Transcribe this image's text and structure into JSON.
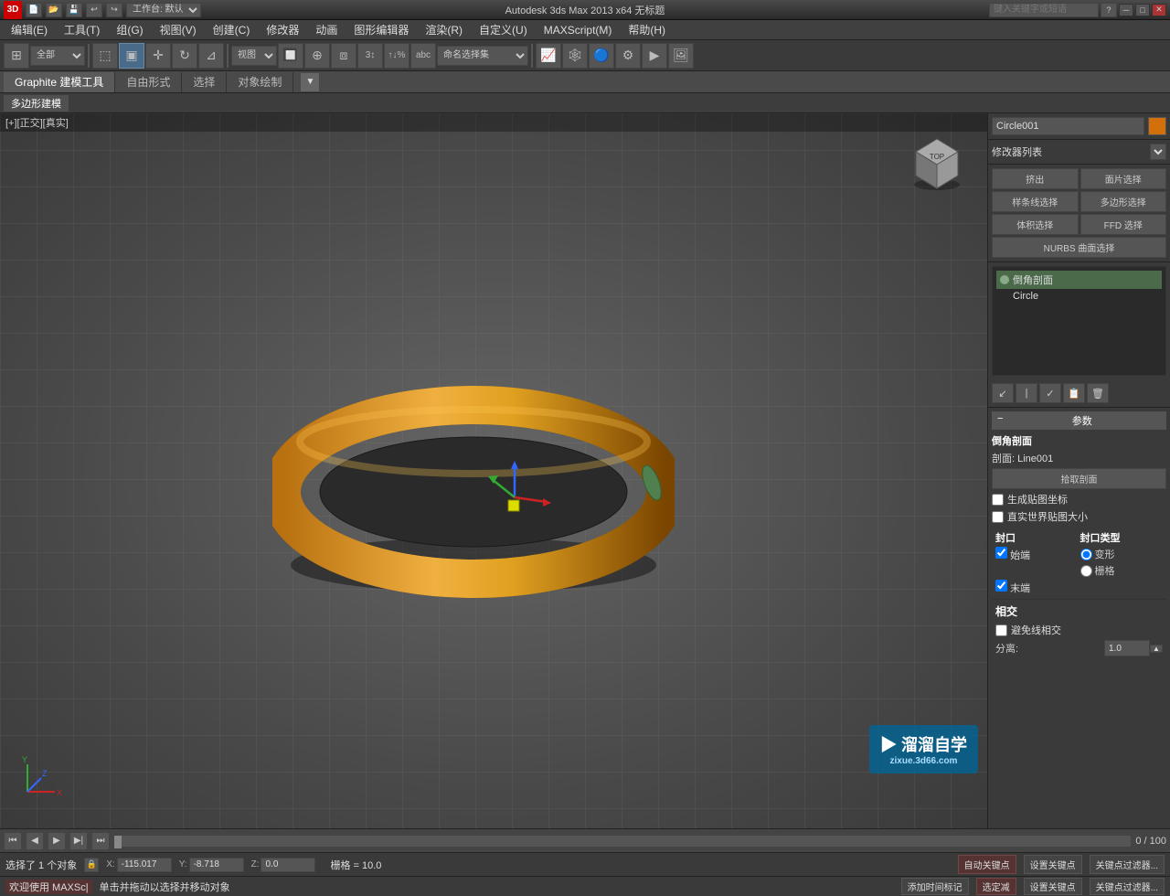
{
  "titlebar": {
    "title": "Autodesk 3ds Max 2013 x64 无标题",
    "logo": "3D",
    "workspace_label": "工作台: 默认",
    "search_placeholder": "键入关键字或短语",
    "min_btn": "─",
    "max_btn": "□",
    "close_btn": "✕"
  },
  "menu": {
    "items": [
      "编辑(E)",
      "工具(T)",
      "组(G)",
      "视图(V)",
      "创建(C)",
      "修改器",
      "动画",
      "图形编辑器",
      "渲染(R)",
      "自定义(U)",
      "MAXScript(M)",
      "帮助(H)"
    ]
  },
  "tabs": {
    "items": [
      "Graphite 建模工具",
      "自由形式",
      "选择",
      "对象绘制"
    ],
    "active": "Graphite 建模工具",
    "sub_item": "多边形建模"
  },
  "viewport": {
    "header": "[+][正交][真实]",
    "object_name": "Circle001"
  },
  "right_panel": {
    "object_name": "Circle001",
    "modifier_list_label": "修改器列表",
    "modifier_buttons": [
      {
        "label": "挤出",
        "wide": false
      },
      {
        "label": "面片选择",
        "wide": false
      },
      {
        "label": "样条线选择",
        "wide": false
      },
      {
        "label": "多边形选择",
        "wide": false
      },
      {
        "label": "体积选择",
        "wide": false
      },
      {
        "label": "FFD 选择",
        "wide": false
      },
      {
        "label": "NURBS 曲面选择",
        "wide": true
      }
    ],
    "modifier_stack": {
      "items": [
        {
          "name": "倒角剖面",
          "active": true,
          "has_icon": true
        },
        {
          "name": "Circle",
          "active": false,
          "has_icon": false
        }
      ]
    },
    "stack_tools": [
      "↙",
      "|",
      "✓",
      "📋",
      "🗑"
    ],
    "params_section": {
      "title": "参数",
      "bevel_section_label": "倒角剖面",
      "section_label": "剖面: Line001",
      "pick_btn": "拾取剖面",
      "checkboxes": [
        {
          "label": "生成贴图坐标",
          "checked": false
        },
        {
          "label": "直实世界贴图大小",
          "checked": false
        }
      ],
      "cap_section": {
        "title": "封口",
        "start_label": "始端",
        "end_label": "末端",
        "start_checked": true,
        "end_checked": true,
        "cap_type_title": "封口类型",
        "morph_label": "变形",
        "grid_label": "栅格",
        "morph_checked": true,
        "grid_checked": false
      },
      "intersect_section": {
        "title": "相交",
        "avoid_label": "避免线相交",
        "avoid_checked": false,
        "separation_label": "分离:",
        "separation_value": "1.0"
      }
    }
  },
  "timeline": {
    "frame_current": "0",
    "frame_total": "100"
  },
  "status": {
    "text": "选择了 1 个对象",
    "coord_x_label": "X:",
    "coord_x_value": "-115.017",
    "coord_y_label": "Y:",
    "coord_y_value": "-8.718",
    "coord_z_label": "Z:",
    "coord_z_value": "0.0",
    "grid_label": "栅格 = 10.0",
    "auto_key_label": "自动关键点",
    "set_key_label": "设置关键点",
    "key_filter_label": "关键点过滤器..."
  },
  "bottom_status": {
    "welcome": "欢迎使用 MAXSc|",
    "hint": "单击并拖动以选择并移动对象",
    "add_key_label": "添加时间标记",
    "auto_key_btn": "选定减",
    "set_key_btn": "设置关键点",
    "key_filter_btn": "关键点过滤器..."
  },
  "watermark": {
    "logo": "▶ 溜溜自学",
    "site": "zixue.3d66.com"
  }
}
